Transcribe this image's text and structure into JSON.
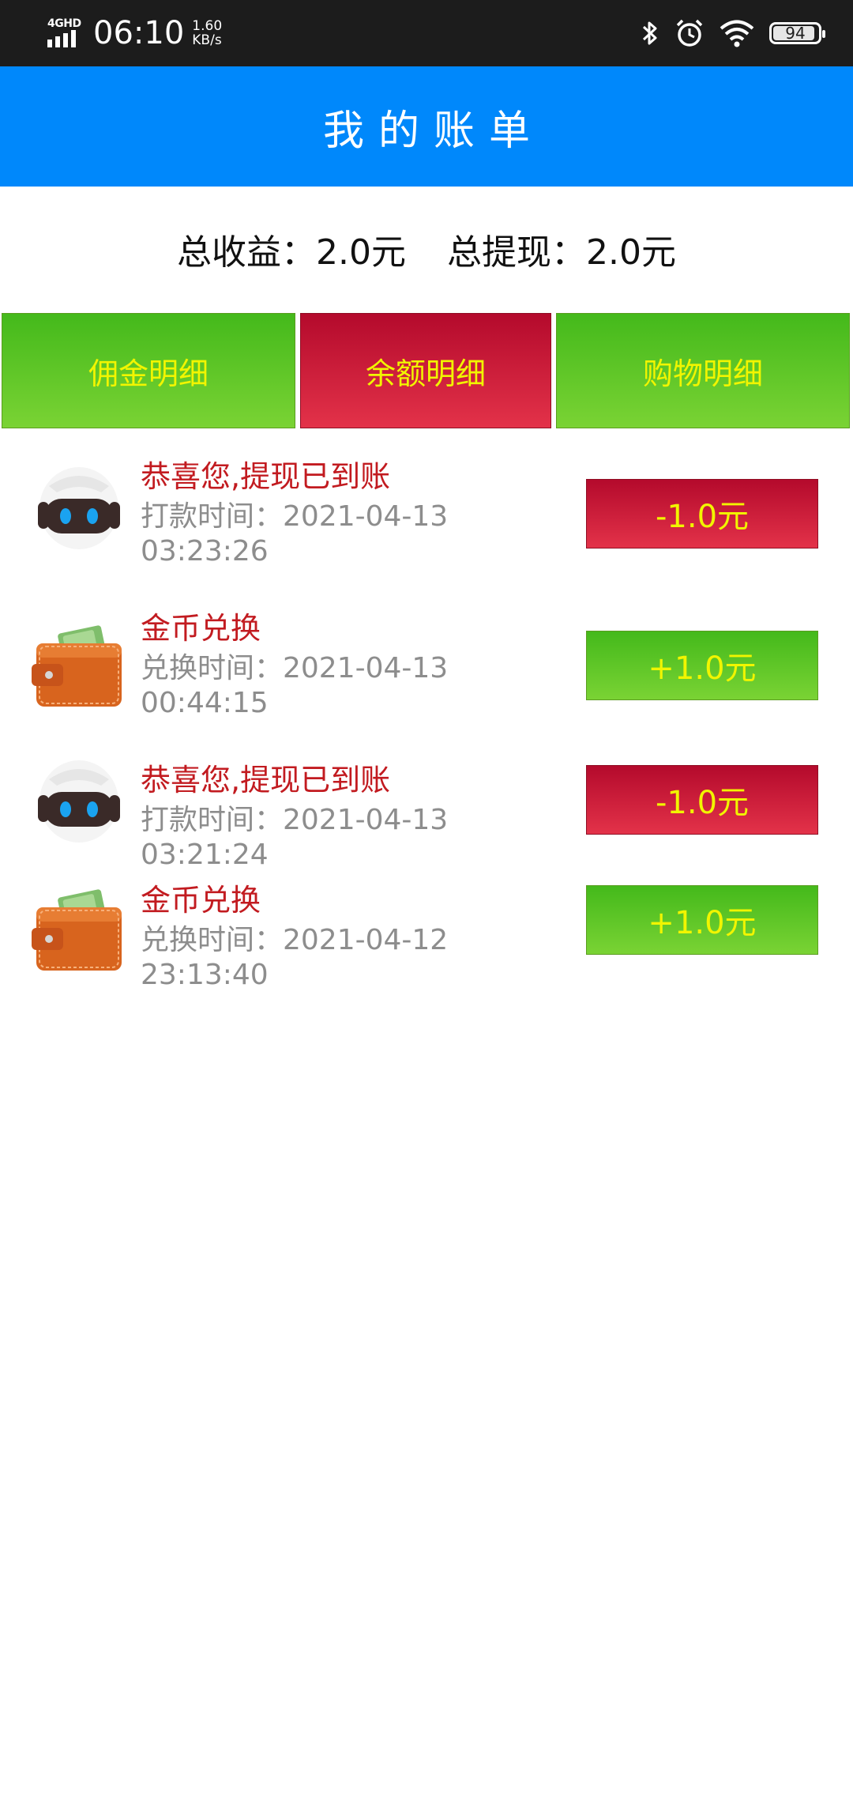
{
  "status_bar": {
    "network": "4GHD",
    "time": "06:10",
    "speed_value": "1.60",
    "speed_unit": "KB/s",
    "battery": "94"
  },
  "header": {
    "title": "我的账单"
  },
  "summary": {
    "total_income": "总收益：2.0元",
    "total_withdraw": "总提现：2.0元"
  },
  "tabs": [
    {
      "label": "佣金明细",
      "color": "#5cc627"
    },
    {
      "label": "余额明细",
      "color": "#c51d39",
      "selected": true
    },
    {
      "label": "购物明细",
      "color": "#5cc627"
    }
  ],
  "records": [
    {
      "icon": "robot-icon",
      "title": "恭喜您,提现已到账",
      "time_line1": "打款时间：2021-04-13",
      "time_line2": "03:23:26",
      "amount": "-1.0元",
      "type": "debit"
    },
    {
      "icon": "wallet-icon",
      "title": "金币兑换",
      "time_line1": "兑换时间：2021-04-13",
      "time_line2": "00:44:15",
      "amount": "+1.0元",
      "type": "credit"
    },
    {
      "icon": "robot-icon",
      "title": "恭喜您,提现已到账",
      "time_line1": "打款时间：2021-04-13 03:21:24",
      "time_line2": "",
      "amount": "-1.0元",
      "type": "debit"
    },
    {
      "icon": "wallet-icon",
      "title": "金币兑换",
      "time_line1": "兑换时间：2021-04-12 23:13:40",
      "time_line2": "",
      "amount": "+1.0元",
      "type": "credit"
    }
  ],
  "colors": {
    "header_bg": "#0088fb",
    "title_red": "#c21b20",
    "button_text": "#f1f500"
  }
}
